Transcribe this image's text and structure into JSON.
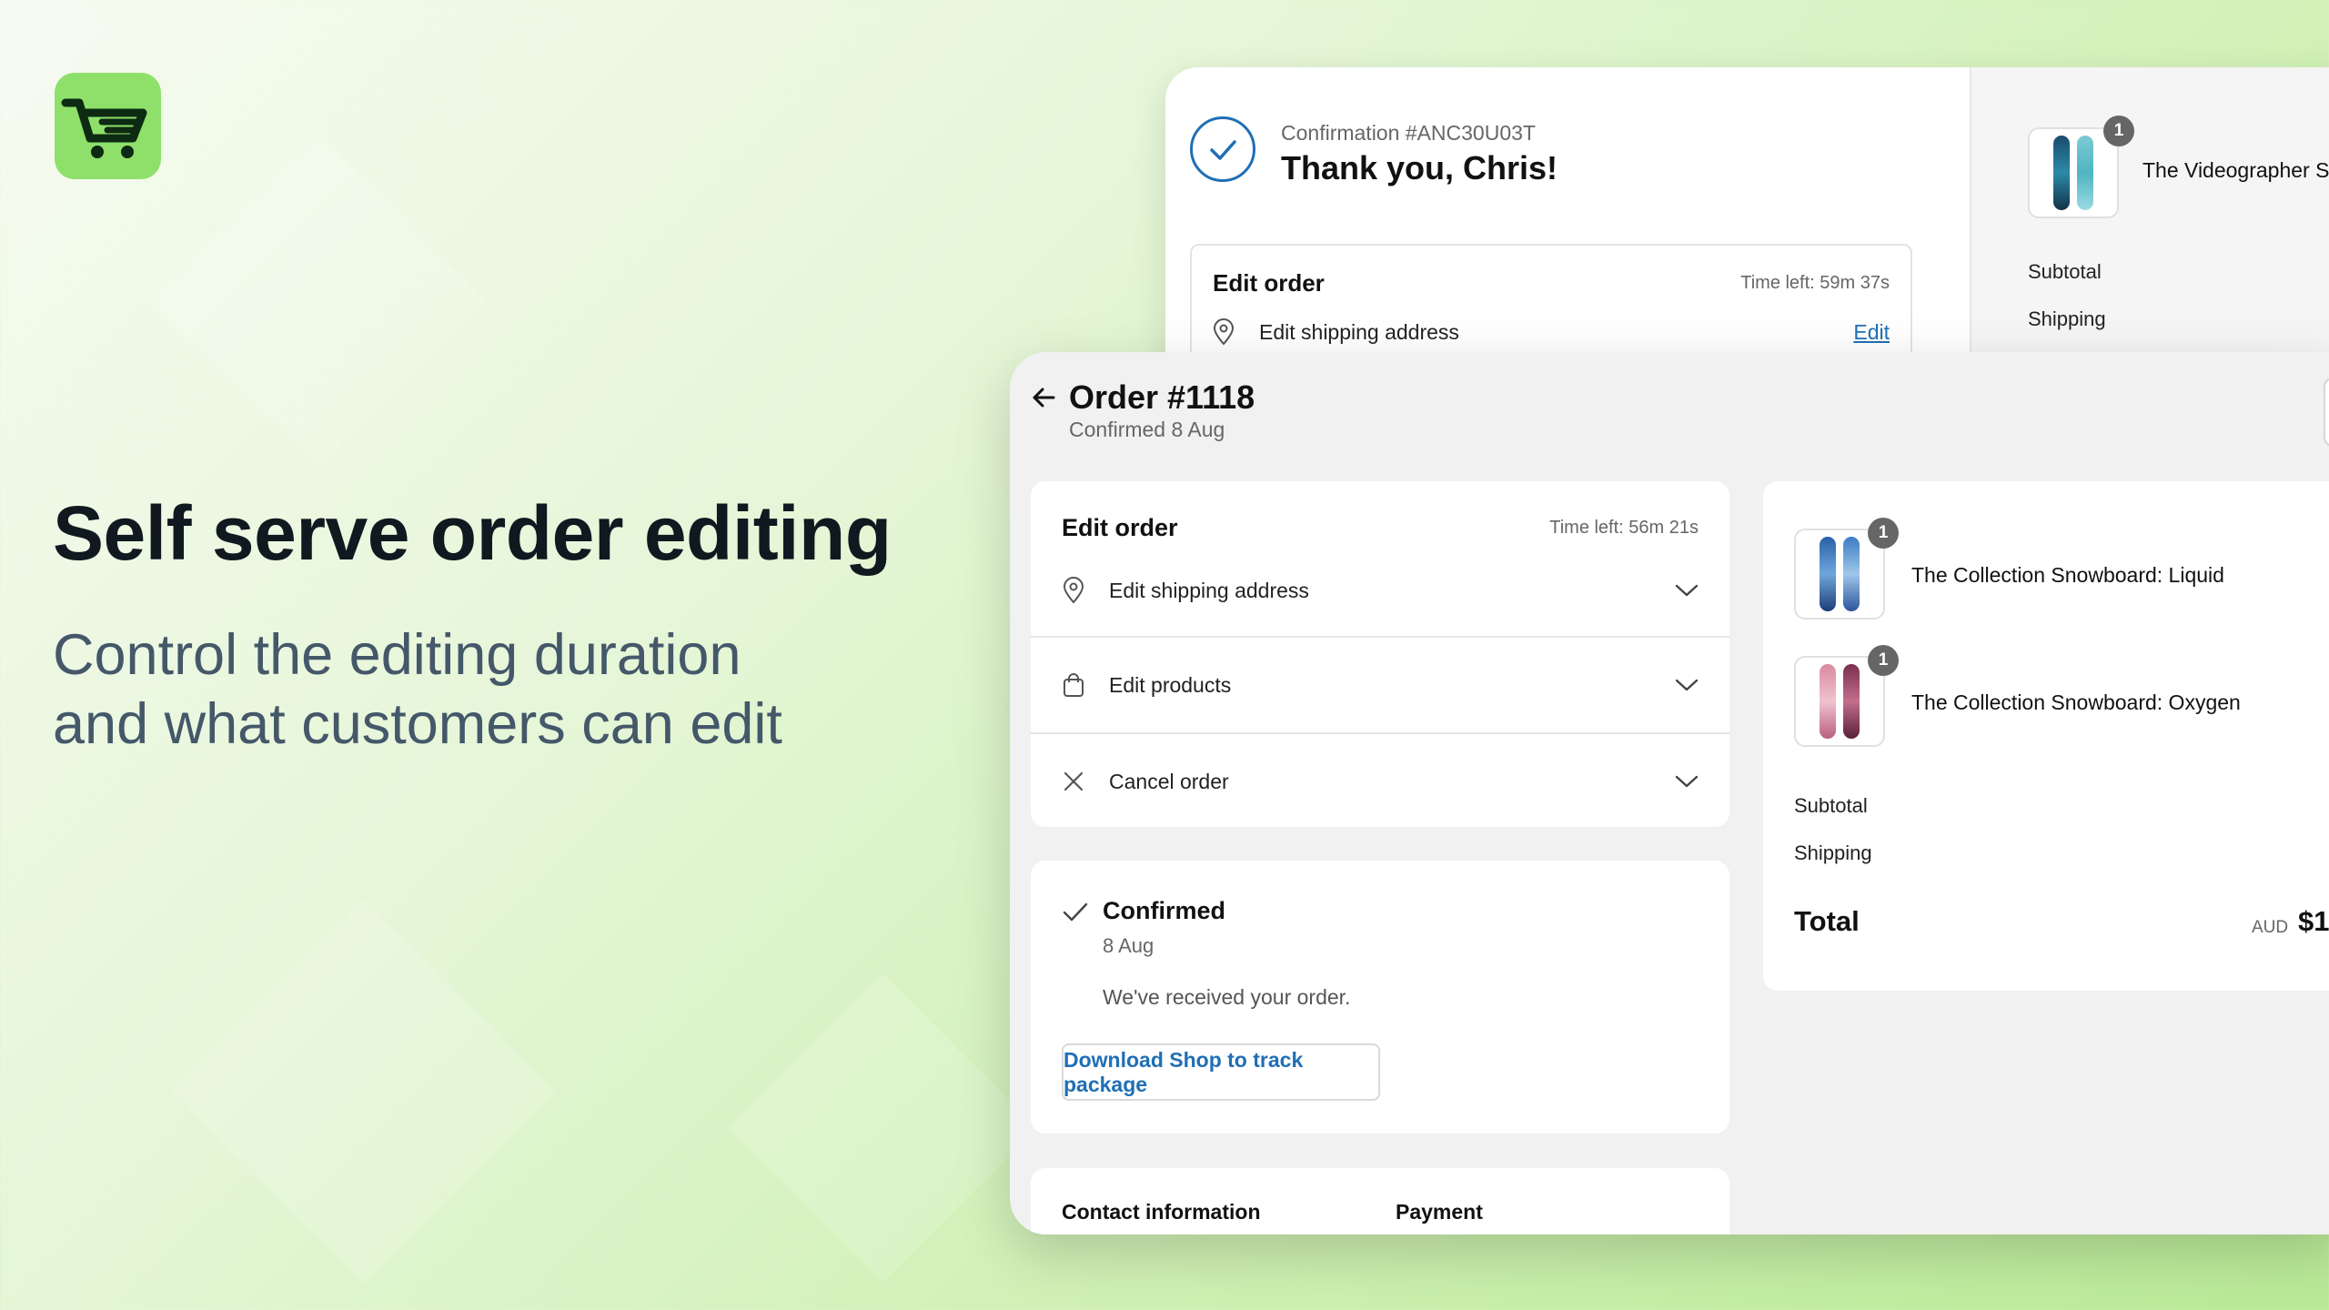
{
  "colors": {
    "accent": "#8ee06a",
    "link": "#1f6fb5",
    "heading": "#101820",
    "subtext": "#45586a"
  },
  "logo": {
    "icon": "shopping-cart-icon"
  },
  "hero": {
    "title": "Self serve order editing",
    "subtitle_lines": [
      "Control the editing duration",
      "and what customers can edit"
    ]
  },
  "confirmation_window": {
    "confirmation": "Confirmation #ANC30U03T",
    "thank_you": "Thank you, Chris!",
    "edit_order": {
      "title": "Edit order",
      "time_left": "Time left: 59m 37s",
      "shipping_label": "Edit shipping address",
      "edit_link": "Edit"
    },
    "summary": {
      "product": {
        "name": "The Videographer S",
        "qty": "1"
      },
      "subtotal_label": "Subtotal",
      "shipping_label": "Shipping"
    }
  },
  "order_window": {
    "title": "Order #1118",
    "subtitle": "Confirmed 8 Aug",
    "edit_order": {
      "title": "Edit order",
      "time_left": "Time left: 56m 21s",
      "rows": [
        {
          "label": "Edit shipping address",
          "icon": "location-pin-icon"
        },
        {
          "label": "Edit products",
          "icon": "shopping-bag-icon"
        },
        {
          "label": "Cancel order",
          "icon": "close-icon"
        }
      ]
    },
    "status": {
      "title": "Confirmed",
      "date": "8 Aug",
      "message": "We've received your order.",
      "button": "Download Shop to track package"
    },
    "contact_label": "Contact information",
    "payment_label": "Payment",
    "summary": {
      "items": [
        {
          "name": "The Collection Snowboard: Liquid",
          "qty": "1"
        },
        {
          "name": "The Collection Snowboard: Oxygen",
          "qty": "1"
        }
      ],
      "subtotal_label": "Subtotal",
      "shipping_label": "Shipping",
      "total_label": "Total",
      "currency": "AUD",
      "total_value": "$1"
    }
  }
}
